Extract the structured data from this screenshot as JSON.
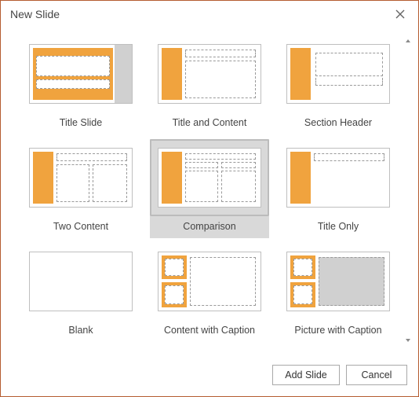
{
  "dialog": {
    "title": "New Slide"
  },
  "layouts": [
    {
      "id": "title-slide",
      "label": "Title Slide"
    },
    {
      "id": "title-and-content",
      "label": "Title and Content"
    },
    {
      "id": "section-header",
      "label": "Section Header"
    },
    {
      "id": "two-content",
      "label": "Two Content"
    },
    {
      "id": "comparison",
      "label": "Comparison"
    },
    {
      "id": "title-only",
      "label": "Title Only"
    },
    {
      "id": "blank",
      "label": "Blank"
    },
    {
      "id": "content-with-caption",
      "label": "Content with Caption"
    },
    {
      "id": "picture-with-caption",
      "label": "Picture with Caption"
    }
  ],
  "selected_layout": "comparison",
  "buttons": {
    "add": "Add Slide",
    "cancel": "Cancel"
  }
}
